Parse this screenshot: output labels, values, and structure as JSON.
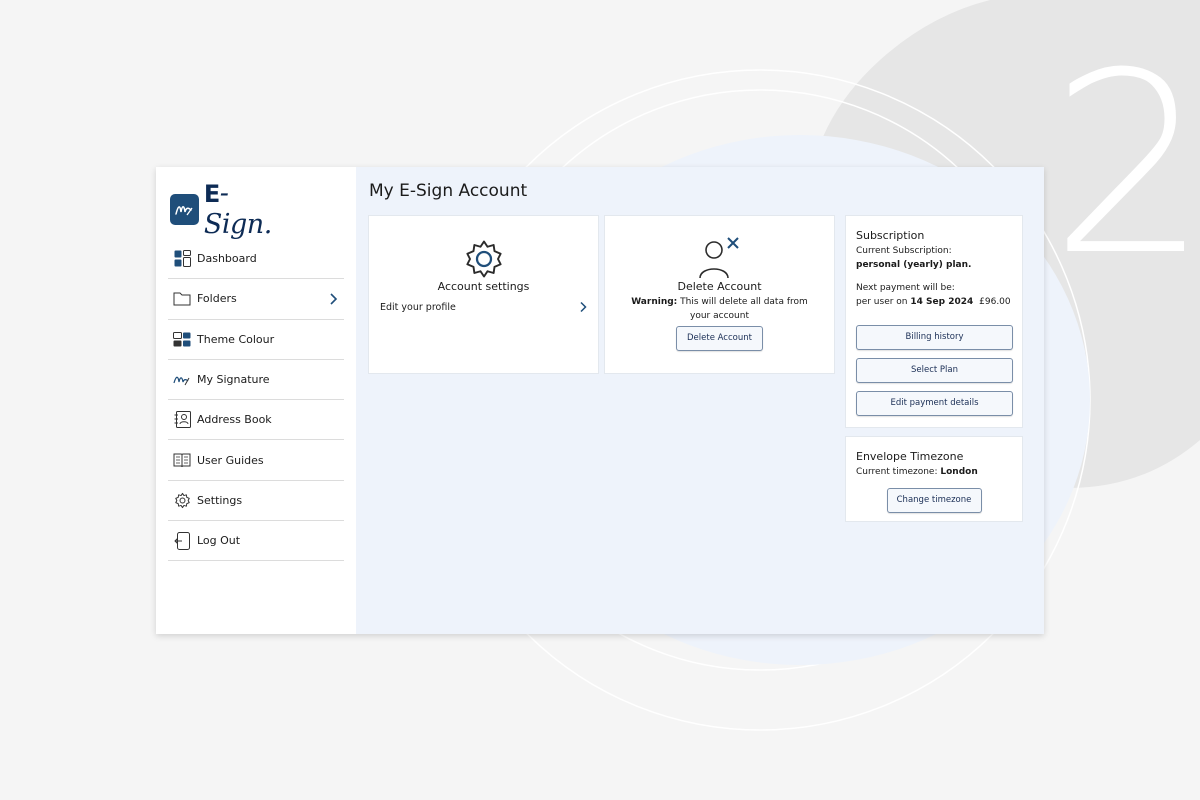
{
  "background": {
    "step_number": "2",
    "accent_color": "#0d2b55",
    "page_bg": "#f5f5f5"
  },
  "brand": {
    "logo_text": "E-Sign",
    "logo_mark_color": "#1f4e7a"
  },
  "sidebar": {
    "items": [
      {
        "label": "Dashboard",
        "icon": "dashboard-icon"
      },
      {
        "label": "Folders",
        "icon": "folder-icon",
        "has_chevron": true
      },
      {
        "label": "Theme Colour",
        "icon": "palette-icon"
      },
      {
        "label": "My Signature",
        "icon": "signature-icon"
      },
      {
        "label": "Address Book",
        "icon": "address-book-icon"
      },
      {
        "label": "User Guides",
        "icon": "book-icon"
      },
      {
        "label": "Settings",
        "icon": "gear-icon"
      },
      {
        "label": "Log Out",
        "icon": "logout-icon"
      }
    ]
  },
  "main": {
    "title": "My E-Sign Account",
    "account_settings": {
      "title": "Account settings",
      "link_label": "Edit your profile"
    },
    "delete_account": {
      "title": "Delete Account",
      "warning_label": "Warning:",
      "warning_text": "This will delete all data from your account",
      "button_label": "Delete Account"
    },
    "subscription": {
      "title": "Subscription",
      "current_label": "Current Subscription:",
      "current_value": "personal (yearly) plan.",
      "next_payment_label": "Next payment will be:",
      "per_user_text": "per user on",
      "next_date": "14 Sep 2024",
      "amount": "£96.00",
      "buttons": {
        "billing": "Billing history",
        "plan": "Select Plan",
        "payment": "Edit payment details"
      }
    },
    "timezone": {
      "title": "Envelope Timezone",
      "current_label": "Current timezone:",
      "current_value": "London",
      "button_label": "Change timezone"
    }
  },
  "chat": {
    "icon": "chat-icon",
    "color": "#0f2448"
  }
}
